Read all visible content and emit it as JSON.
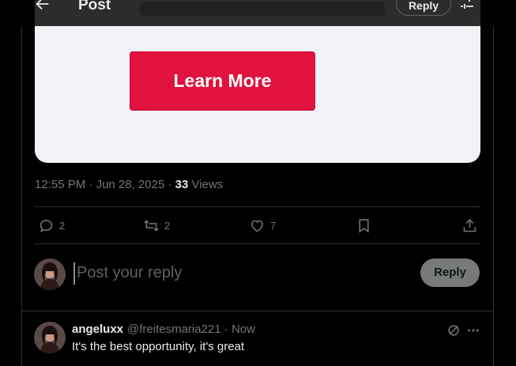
{
  "header": {
    "title": "Post",
    "reply_label": "Reply"
  },
  "ad": {
    "cta_label": "Learn More"
  },
  "meta": {
    "time": "12:55 PM",
    "sep1": " · ",
    "date": "Jun 28, 2025",
    "sep2": " · ",
    "views": "33",
    "views_label": " Views"
  },
  "actions": {
    "replies": "2",
    "reposts": "2",
    "likes": "7"
  },
  "compose": {
    "placeholder": "Post your reply",
    "button_label": "Reply"
  },
  "reply": {
    "name": "angeluxx",
    "handle": "@freitesmaria221",
    "sep": " · ",
    "time": "Now",
    "text": "It's the best opportunity, it's great"
  },
  "colors": {
    "accent": "#e2123e",
    "background": "#000000",
    "muted": "#71767b"
  }
}
